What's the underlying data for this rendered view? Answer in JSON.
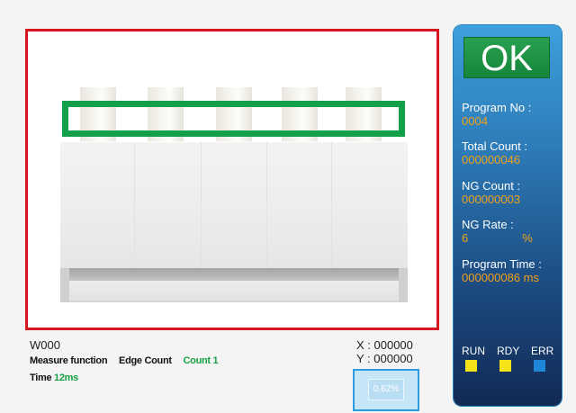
{
  "camera_view": {
    "roi_color": "#12a04a",
    "frame_color": "#d4161e"
  },
  "info": {
    "tool_id": "W000",
    "measure_label": "Measure function",
    "function_name": "Edge Count",
    "count_text": "Count 1",
    "time_label": "Time",
    "time_value": "12ms",
    "x_text": "X : 000000",
    "y_text": "Y : 000000",
    "thumb_percent": "0.62%"
  },
  "panel": {
    "result": "OK",
    "program_no_label": "Program No :",
    "program_no": "0004",
    "total_count_label": "Total Count :",
    "total_count": "000000046",
    "ng_count_label": "NG Count :",
    "ng_count": "000000003",
    "ng_rate_label": "NG Rate :",
    "ng_rate": "6",
    "ng_rate_unit": "%",
    "program_time_label": "Program Time :",
    "program_time": "000000086 ms",
    "indicators": [
      {
        "label": "RUN",
        "color": "#f7e418"
      },
      {
        "label": "RDY",
        "color": "#f7e418"
      },
      {
        "label": "ERR",
        "color": "#1e87d8"
      }
    ]
  }
}
